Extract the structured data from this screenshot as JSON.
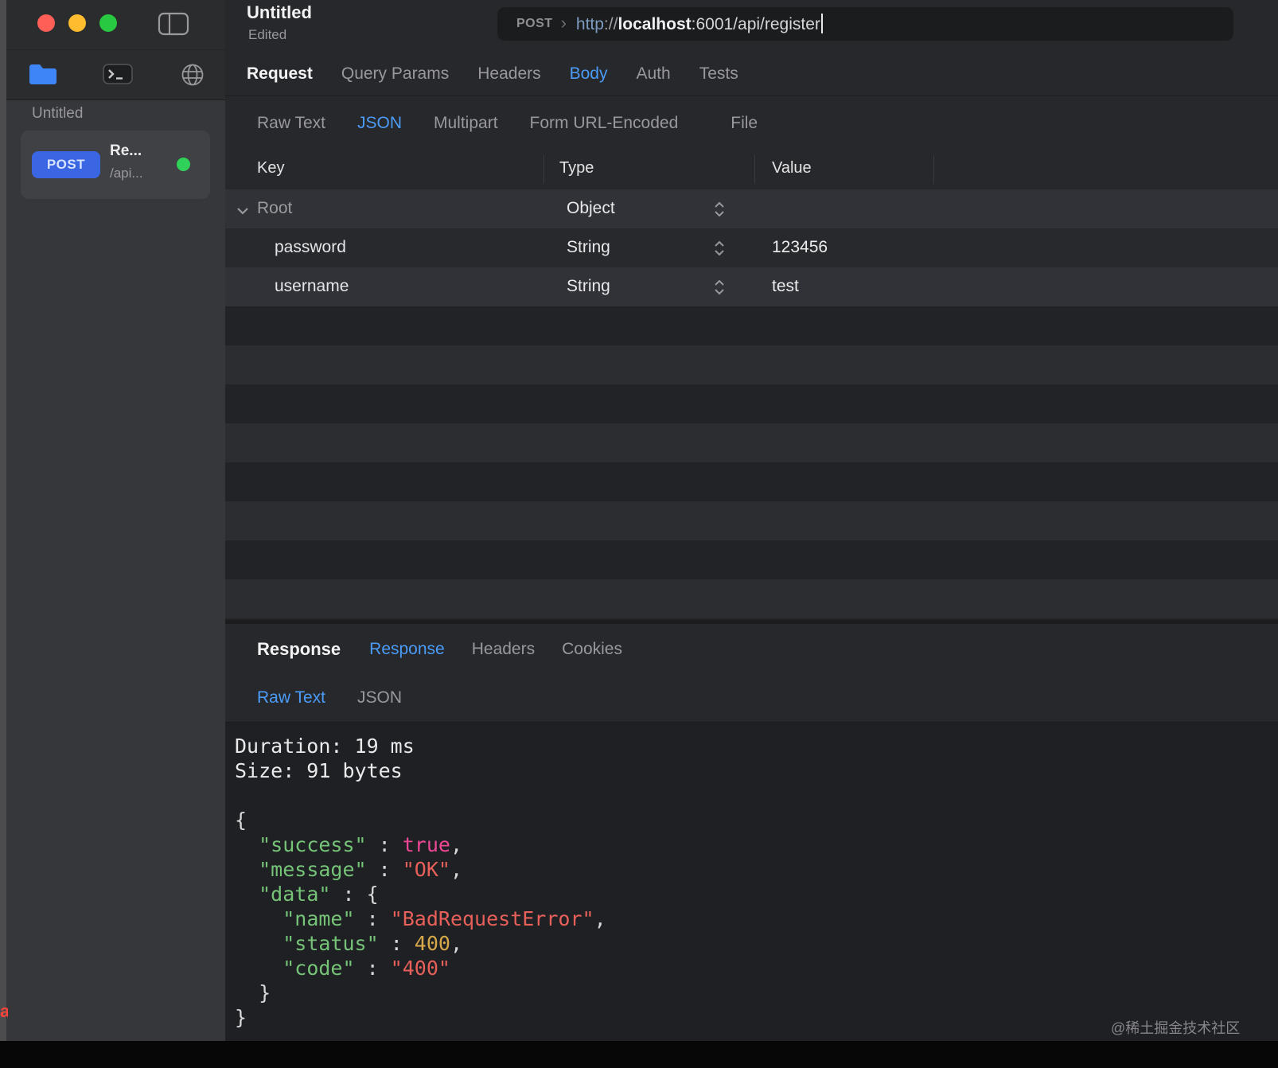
{
  "colors": {
    "accent_blue": "#4b9cf8",
    "code": {
      "plain": "#eaeaec",
      "key": "#75c478",
      "string": "#e8605a",
      "bool": "#ed4795",
      "number": "#d7a94b",
      "punct": "#d8d8da"
    },
    "method_badge_bg": "#3a66e3",
    "status_dot_green": "#30d158"
  },
  "edge_text": "a",
  "sidebar": {
    "section_label": "Untitled",
    "request": {
      "method": "POST",
      "name": "Re...",
      "path": "/api..."
    }
  },
  "header": {
    "title": "Untitled",
    "subtitle": "Edited",
    "url": {
      "method": "POST",
      "chevron": "›",
      "scheme": "http",
      "sep": "://",
      "host": "localhost",
      "rest": ":6001/api/register"
    }
  },
  "request_tabs": [
    "Request",
    "Query Params",
    "Headers",
    "Body",
    "Auth",
    "Tests"
  ],
  "body_tabs": [
    "Raw Text",
    "JSON",
    "Multipart",
    "Form URL-Encoded",
    "File"
  ],
  "table": {
    "columns": [
      "Key",
      "Type",
      "Value"
    ],
    "rows": [
      {
        "key": "Root",
        "type": "Object",
        "value": ""
      },
      {
        "key": "password",
        "type": "String",
        "value": "123456"
      },
      {
        "key": "username",
        "type": "String",
        "value": "test"
      }
    ]
  },
  "response": {
    "section_label": "Response",
    "tabs": [
      "Response",
      "Headers",
      "Cookies"
    ],
    "sub_tabs": [
      "Raw Text",
      "JSON"
    ],
    "code_lines": [
      [
        {
          "t": "plain",
          "v": "Duration: 19 ms"
        }
      ],
      [
        {
          "t": "plain",
          "v": "Size: 91 bytes"
        }
      ],
      [],
      [
        {
          "t": "punct",
          "v": "{"
        }
      ],
      [
        {
          "t": "punct",
          "v": "  "
        },
        {
          "t": "key",
          "v": "\"success\""
        },
        {
          "t": "punct",
          "v": " : "
        },
        {
          "t": "bool",
          "v": "true"
        },
        {
          "t": "punct",
          "v": ","
        }
      ],
      [
        {
          "t": "punct",
          "v": "  "
        },
        {
          "t": "key",
          "v": "\"message\""
        },
        {
          "t": "punct",
          "v": " : "
        },
        {
          "t": "string",
          "v": "\"OK\""
        },
        {
          "t": "punct",
          "v": ","
        }
      ],
      [
        {
          "t": "punct",
          "v": "  "
        },
        {
          "t": "key",
          "v": "\"data\""
        },
        {
          "t": "punct",
          "v": " : {"
        }
      ],
      [
        {
          "t": "punct",
          "v": "    "
        },
        {
          "t": "key",
          "v": "\"name\""
        },
        {
          "t": "punct",
          "v": " : "
        },
        {
          "t": "string",
          "v": "\"BadRequestError\""
        },
        {
          "t": "punct",
          "v": ","
        }
      ],
      [
        {
          "t": "punct",
          "v": "    "
        },
        {
          "t": "key",
          "v": "\"status\""
        },
        {
          "t": "punct",
          "v": " : "
        },
        {
          "t": "number",
          "v": "400"
        },
        {
          "t": "punct",
          "v": ","
        }
      ],
      [
        {
          "t": "punct",
          "v": "    "
        },
        {
          "t": "key",
          "v": "\"code\""
        },
        {
          "t": "punct",
          "v": " : "
        },
        {
          "t": "string",
          "v": "\"400\""
        }
      ],
      [
        {
          "t": "punct",
          "v": "  }"
        }
      ],
      [
        {
          "t": "punct",
          "v": "}"
        }
      ]
    ]
  },
  "watermark": "@稀土掘金技术社区"
}
